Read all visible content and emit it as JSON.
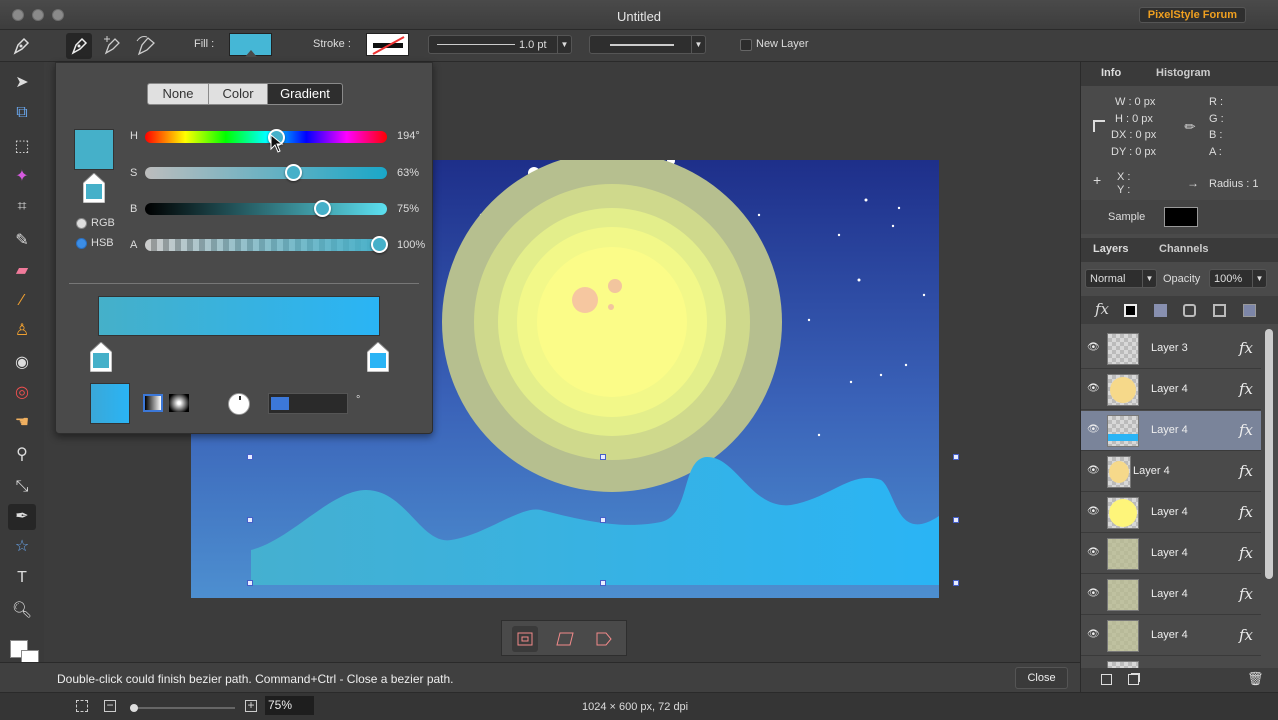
{
  "window": {
    "title": "Untitled",
    "forum_button": "PixelStyle Forum"
  },
  "options_bar": {
    "fill_label": "Fill :",
    "fill_color": "#45b7d6",
    "stroke_label": "Stroke :",
    "stroke_width": "1.0 pt",
    "new_layer_label": "New Layer"
  },
  "color_popover": {
    "tabs": [
      "None",
      "Color",
      "Gradient"
    ],
    "active_tab": "Gradient",
    "sliders": [
      {
        "label": "H",
        "value": "194°",
        "fraction": 0.54
      },
      {
        "label": "S",
        "value": "63%",
        "fraction": 0.63
      },
      {
        "label": "B",
        "value": "75%",
        "fraction": 0.75
      },
      {
        "label": "A",
        "value": "100%",
        "fraction": 1.0
      }
    ],
    "modes": [
      "RGB",
      "HSB"
    ],
    "active_mode": "HSB",
    "gradient_start": "#45b0c9",
    "gradient_end": "#2ab4f5",
    "angle_unit": "°"
  },
  "status": {
    "message": "Double-click could finish bezier path. Command+Ctrl - Close a bezier path.",
    "close_button": "Close"
  },
  "bottom": {
    "zoom": "75%",
    "canvas_info": "1024 × 600 px, 72 dpi"
  },
  "info_panel": {
    "tabs": [
      "Info",
      "Histogram"
    ],
    "w": "W :  0 px",
    "h": "H :  0 px",
    "dx": "DX :  0 px",
    "dy": "DY :  0 px",
    "r": "R :",
    "g": "G :",
    "b": "B :",
    "a": "A :",
    "x": "X :",
    "y": "Y :",
    "radius": "Radius :  1",
    "sample_label": "Sample",
    "sample_color": "#000000"
  },
  "layers_panel": {
    "tabs": [
      "Layers",
      "Channels"
    ],
    "blend_mode": "Normal",
    "opacity_label": "Opacity",
    "opacity": "100%",
    "layers": [
      {
        "name": "Layer 3",
        "thumb": "transparent"
      },
      {
        "name": "Layer 4",
        "thumb": "#f6d98a"
      },
      {
        "name": "Layer 4",
        "thumb": "wave",
        "selected": true
      },
      {
        "name": "Layer 4",
        "thumb": "#f6d98a"
      },
      {
        "name": "Layer 4",
        "thumb": "#fef57a"
      },
      {
        "name": "Layer 4",
        "thumb": "#b7b98e"
      },
      {
        "name": "Layer 4",
        "thumb": "#b7b98e"
      },
      {
        "name": "Layer 4",
        "thumb": "#b7b98e"
      }
    ]
  }
}
